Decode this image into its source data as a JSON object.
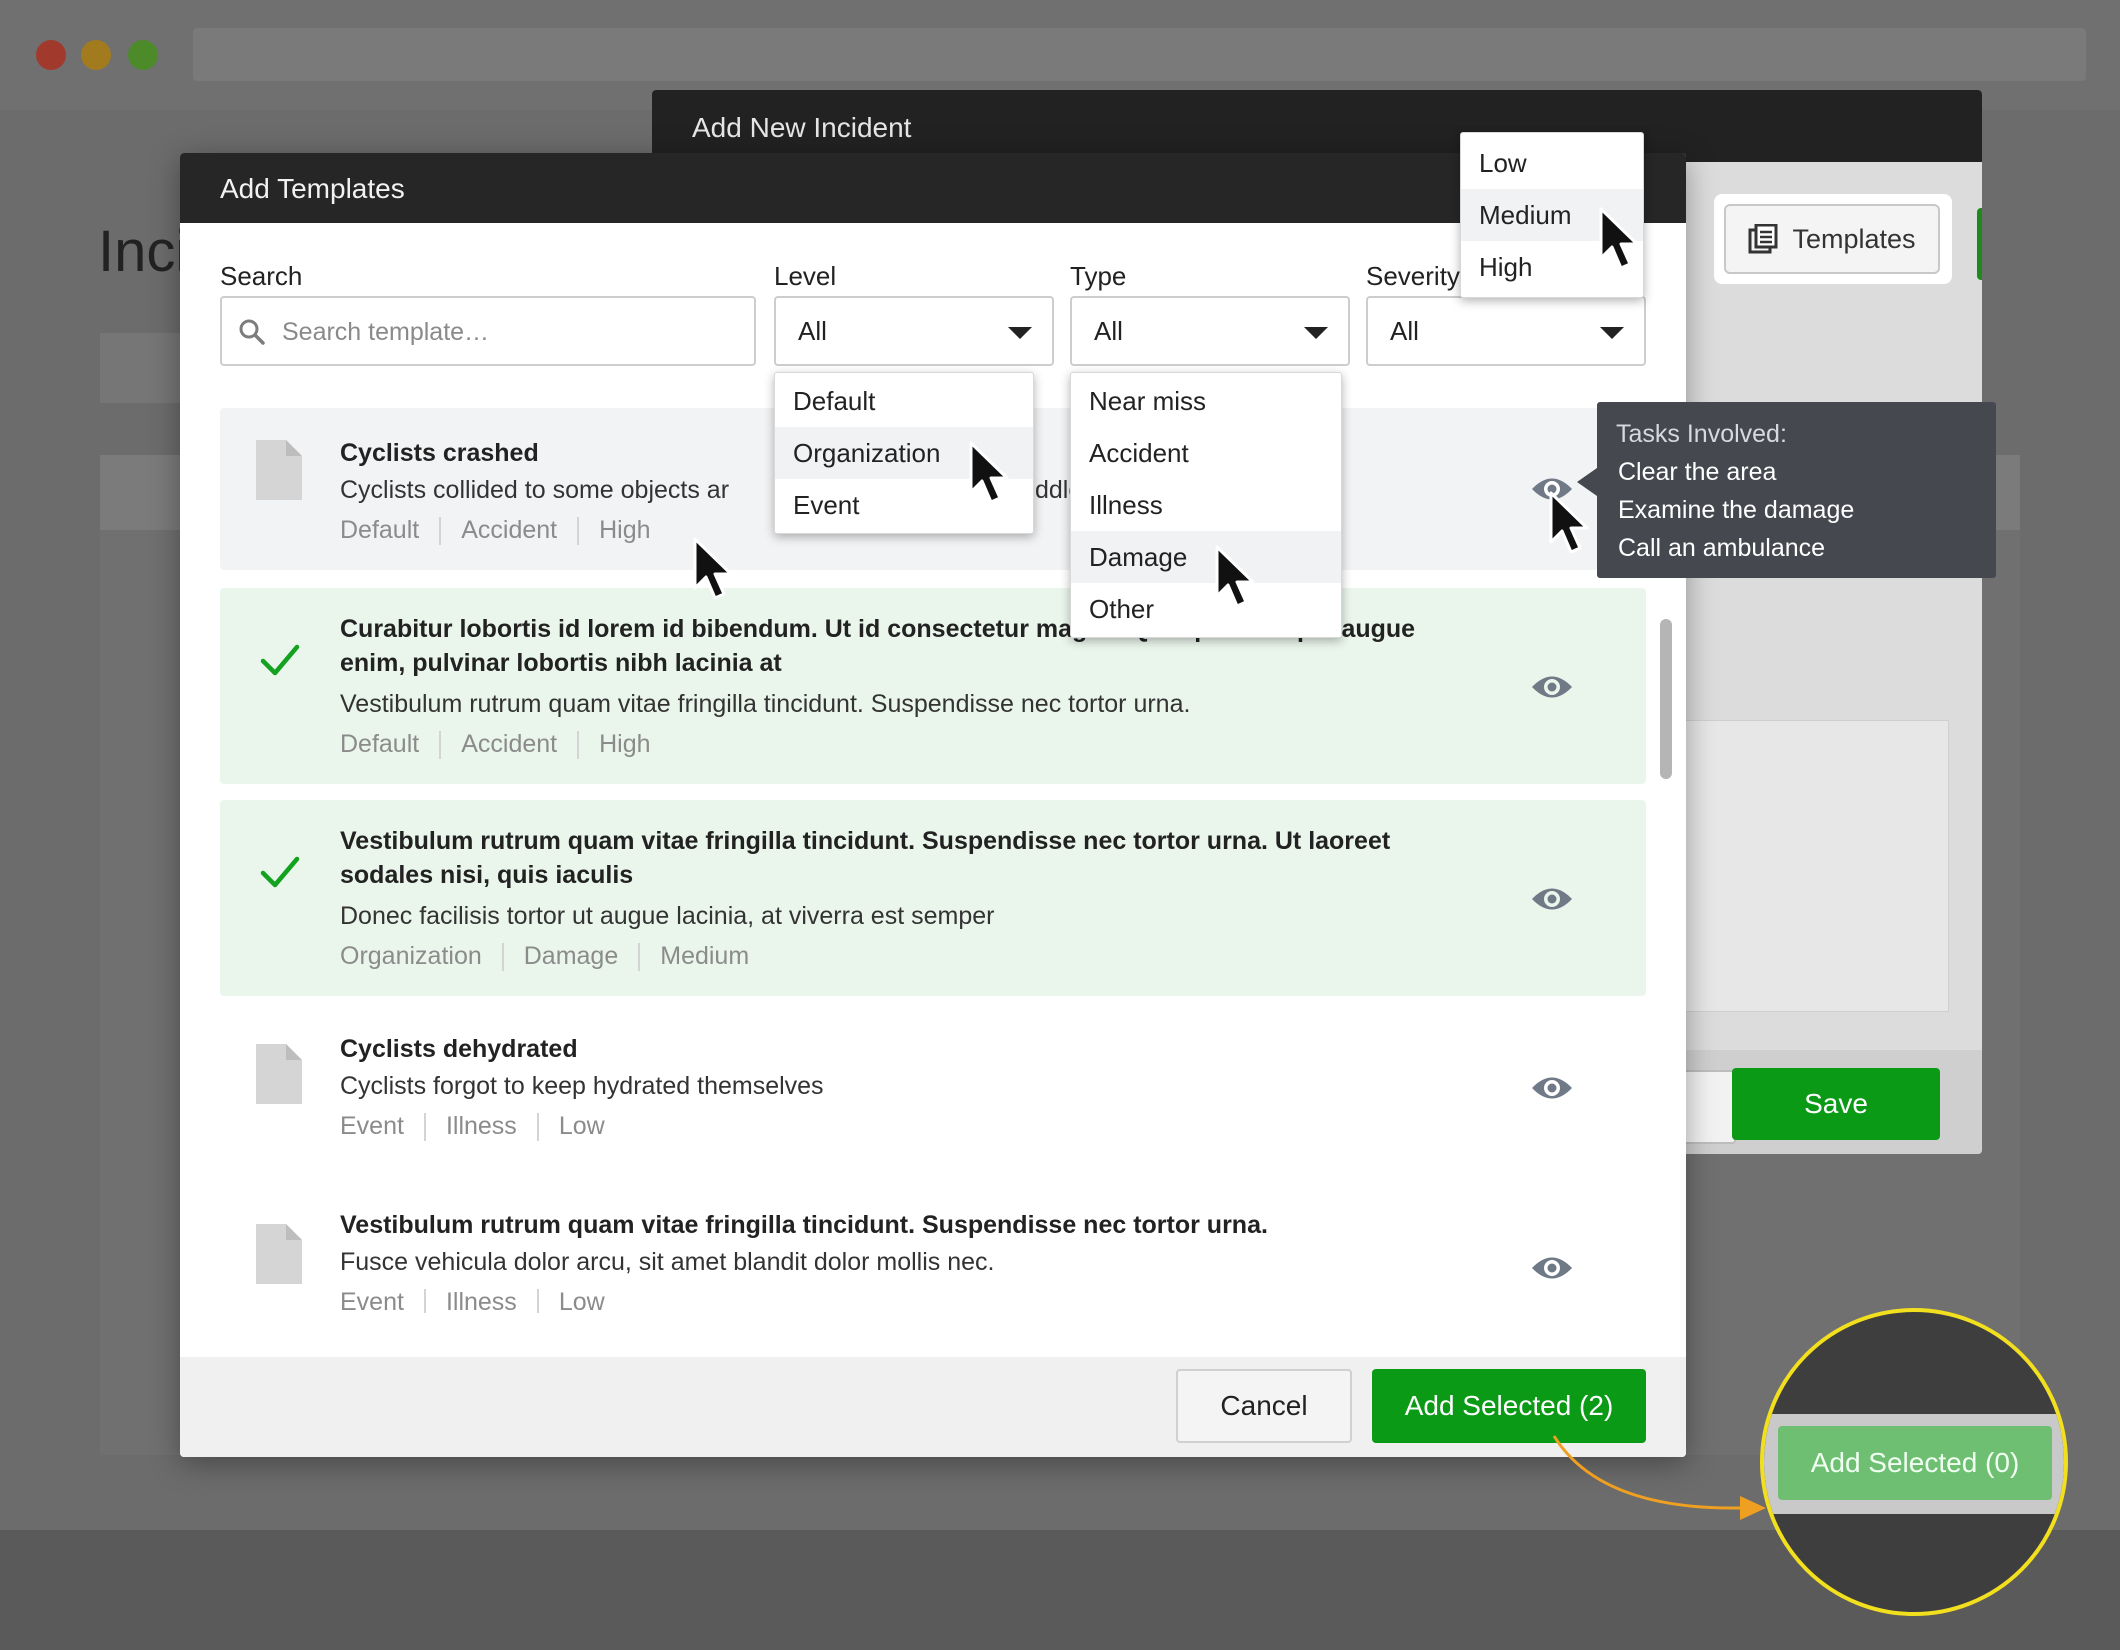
{
  "background": {
    "page_title": "Inci"
  },
  "incident_dialog": {
    "title": "Add New Incident",
    "templates_label": "Templates",
    "save_label": "Save"
  },
  "dialog": {
    "title": "Add Templates",
    "search": {
      "label": "Search",
      "placeholder": "Search template…",
      "value": ""
    },
    "filters": {
      "level": {
        "label": "Level",
        "value": "All",
        "options": [
          "Default",
          "Organization",
          "Event"
        ]
      },
      "type": {
        "label": "Type",
        "value": "All",
        "options": [
          "Near miss",
          "Accident",
          "Illness",
          "Damage",
          "Other"
        ]
      },
      "severity": {
        "label": "Severity",
        "value": "All",
        "options": [
          "Low",
          "Medium",
          "High"
        ]
      }
    },
    "templates": [
      {
        "title": "Cyclists crashed",
        "desc": "Cyclists collided to some objects ar",
        "desc_tail": "ddle",
        "level": "Default",
        "type": "Accident",
        "severity": "High",
        "selected": false
      },
      {
        "title": "Curabitur lobortis id lorem id bibendum. Ut id consectetur magna. Quisque volutpat augue enim, pulvinar lobortis nibh lacinia at",
        "desc": "Vestibulum rutrum quam vitae fringilla tincidunt. Suspendisse nec tortor urna.",
        "level": "Default",
        "type": "Accident",
        "severity": "High",
        "selected": true
      },
      {
        "title": "Vestibulum rutrum quam vitae fringilla tincidunt. Suspendisse nec tortor urna. Ut laoreet sodales nisi, quis iaculis",
        "desc": "Donec facilisis tortor ut augue lacinia, at viverra est semper",
        "level": "Organization",
        "type": "Damage",
        "severity": "Medium",
        "selected": true
      },
      {
        "title": "Cyclists dehydrated",
        "desc": "Cyclists forgot to keep hydrated themselves",
        "level": "Event",
        "type": "Illness",
        "severity": "Low",
        "selected": false
      },
      {
        "title": "Vestibulum rutrum quam vitae fringilla tincidunt. Suspendisse nec tortor urna.",
        "desc": "Fusce vehicula dolor arcu, sit amet blandit dolor mollis nec.",
        "level": "Event",
        "type": "Illness",
        "severity": "Low",
        "selected": false
      }
    ],
    "tooltip": {
      "heading": "Tasks Involved:",
      "tasks": [
        "Clear the area",
        "Examine the damage",
        "Call an ambulance"
      ]
    },
    "cancel_label": "Cancel",
    "add_selected_label": "Add Selected (2)"
  },
  "callout": {
    "disabled_label": "Add Selected (0)"
  },
  "colors": {
    "primary_green": "#0a9a16",
    "disabled_green": "#6ebf72",
    "selected_row": "#eaf6ec",
    "callout_ring": "#f2df1e",
    "arrow": "#f0a020"
  },
  "icons": [
    "search-icon",
    "file-icon",
    "check-icon",
    "eye-icon",
    "templates-book-icon",
    "caret-down-icon",
    "cursor-icon"
  ]
}
